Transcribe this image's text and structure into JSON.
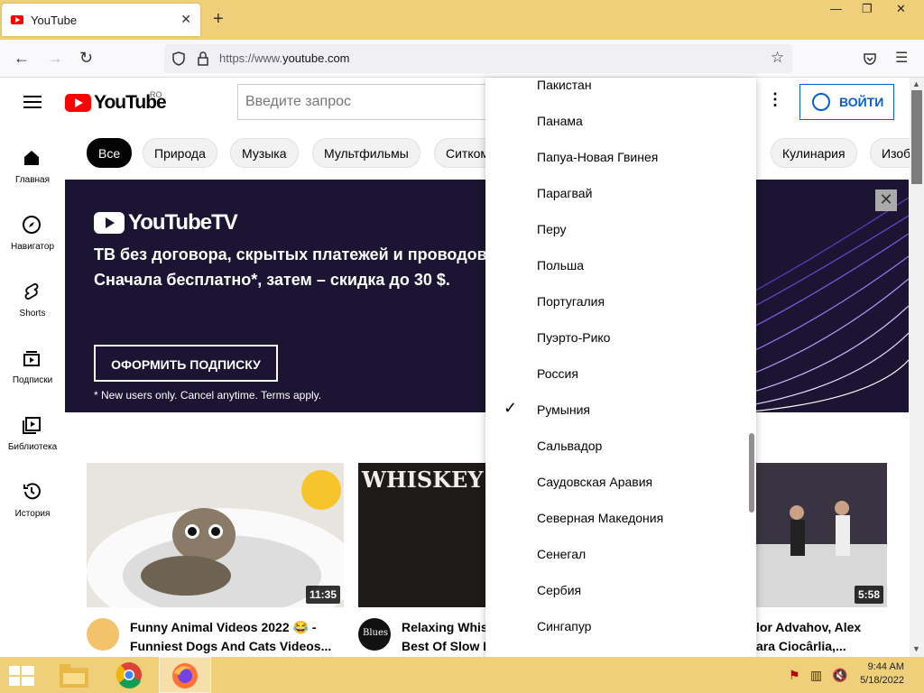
{
  "browser": {
    "tab_title": "YouTube",
    "close_tab": "✕",
    "new_tab": "+",
    "url_dim": "https://www.",
    "url_main": "youtube.com",
    "win_min": "—",
    "win_max": "❐",
    "win_close": "✕"
  },
  "youtube": {
    "logo": "YouTube",
    "country_code": "RO",
    "search_placeholder": "Введите запрос",
    "login_label": "ВОЙТИ",
    "more": "⋮"
  },
  "guide": [
    {
      "label": "Главная"
    },
    {
      "label": "Навигатор"
    },
    {
      "label": "Shorts"
    },
    {
      "label": "Подписки"
    },
    {
      "label": "Библиотека"
    },
    {
      "label": "История"
    }
  ],
  "chips": [
    "Все",
    "Природа",
    "Музыка",
    "Мультфильмы",
    "Ситком",
    "Кулинария",
    "Изоб"
  ],
  "banner": {
    "brand": "YouTubeTV",
    "line1": "ТВ без договора, скрытых платежей и проводов.",
    "line2": "Сначала бесплатно*, затем – скидка до 30 $.",
    "cta": "ОФОРМИТЬ ПОДПИСКУ",
    "terms": "* New users only. Cancel anytime. Terms apply.",
    "close": "✕"
  },
  "videos": [
    {
      "title1": "Funny Animal Videos 2022 😂 -",
      "title2": "Funniest Dogs And Cats Videos...",
      "duration": "11:35"
    },
    {
      "title1": "Relaxing Whisk",
      "title2": "Best Of Slow B",
      "thumb_text": "WHISKEY BLUES",
      "avatar_text": "Blues"
    },
    {
      "title1": "lor Advahov, Alex",
      "title2": "ara Ciocârlia,...",
      "duration": "5:58"
    }
  ],
  "dropdown": {
    "items": [
      {
        "label": "Пакистан"
      },
      {
        "label": "Панама"
      },
      {
        "label": "Папуа-Новая Гвинея"
      },
      {
        "label": "Парагвай"
      },
      {
        "label": "Перу"
      },
      {
        "label": "Польша"
      },
      {
        "label": "Португалия"
      },
      {
        "label": "Пуэрто-Рико"
      },
      {
        "label": "Россия"
      },
      {
        "label": "Румыния",
        "checkmark": "✓"
      },
      {
        "label": "Сальвадор"
      },
      {
        "label": "Саудовская Аравия"
      },
      {
        "label": "Северная Македония"
      },
      {
        "label": "Сенегал"
      },
      {
        "label": "Сербия"
      },
      {
        "label": "Сингапур"
      }
    ]
  },
  "taskbar": {
    "time": "9:44 AM",
    "date": "5/18/2022"
  },
  "colors": {
    "brand_red": "#ff0000",
    "link_blue": "#065fd4",
    "banner_bg": "#1b1432",
    "window_accent": "#f0cf7b"
  }
}
